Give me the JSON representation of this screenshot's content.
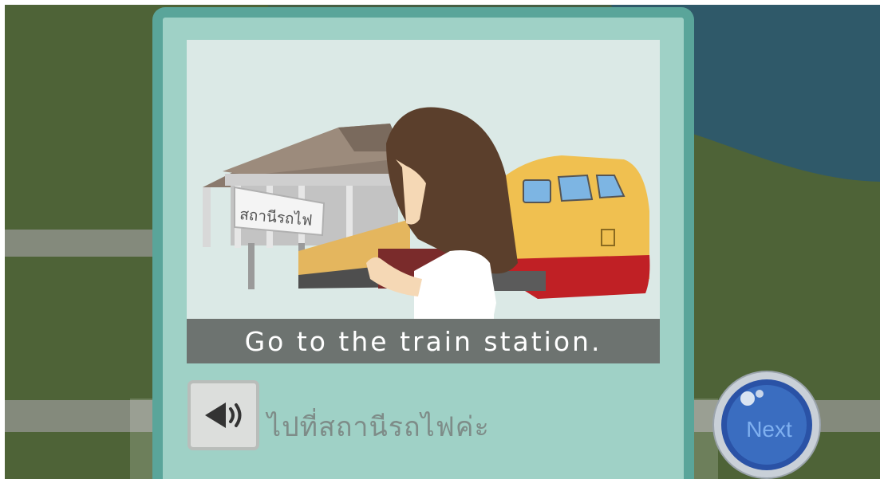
{
  "scene": {
    "station_sign": "สถานีรถไฟ",
    "caption": "Go to the train station."
  },
  "controls": {
    "audio_icon": "speaker-icon",
    "next_label": "Next"
  },
  "translation": {
    "thai_text": "ไปที่สถานีรถไฟค่ะ"
  },
  "colors": {
    "card_border": "#5aa59a",
    "card_fill": "#9fd1c6",
    "caption_bar": "#6d7370",
    "next_button": "#2a52a6",
    "grass": "#4e6337",
    "water": "#2f5969"
  }
}
